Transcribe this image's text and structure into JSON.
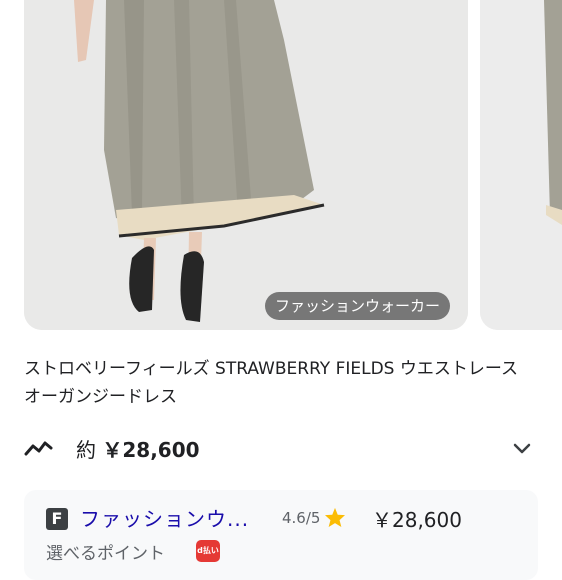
{
  "product": {
    "image_source_label": "ファッションウォーカー",
    "title": "ストロベリーフィールズ STRAWBERRY FIELDS ウエストレースオーガンジードレス"
  },
  "price": {
    "prefix": "約",
    "value": "￥28,600",
    "trend_icon": "price-trend-icon",
    "expand_icon": "chevron-down-icon"
  },
  "seller": {
    "logo_letter": "F",
    "name": "ファッションウ...",
    "rating": "4.6/5",
    "rating_icon": "star-icon",
    "price": "￥28,600",
    "note": "選べるポイント",
    "badge_text": "d払い"
  },
  "colors": {
    "link": "#1a0dab",
    "star": "#fbbc04",
    "points_badge": "#e53935"
  }
}
